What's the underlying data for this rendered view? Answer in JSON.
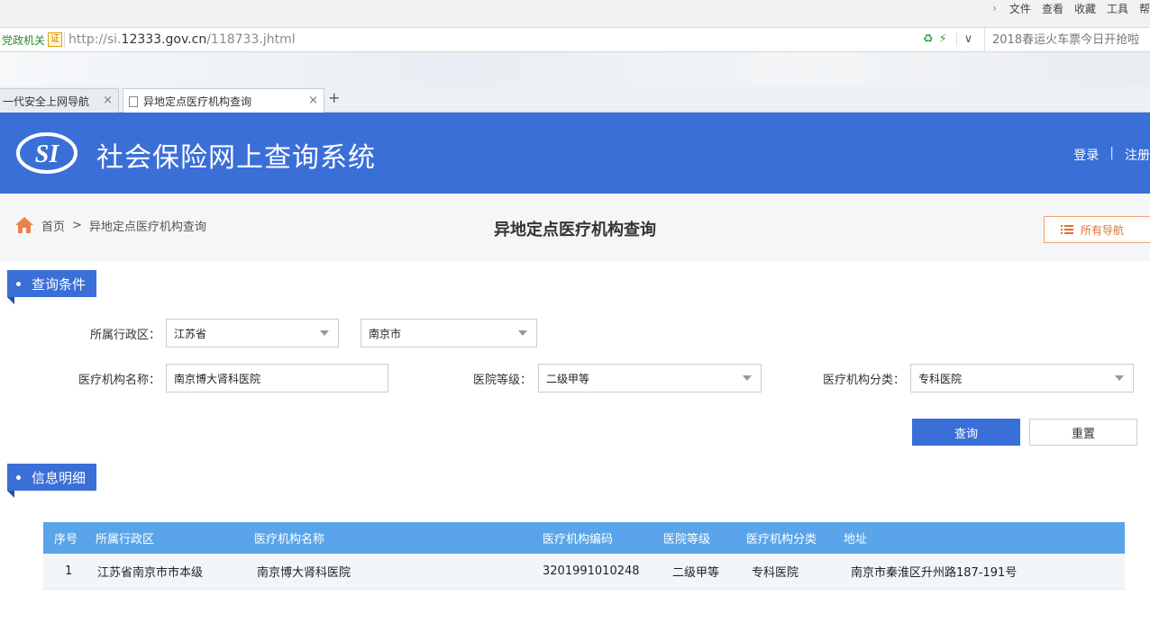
{
  "browser": {
    "menu": [
      "文件",
      "查看",
      "收藏",
      "工具",
      "帮"
    ],
    "gov_badge": "党政机关",
    "gov_badge_mark": "证",
    "url_prefix": "http://si.",
    "url_domain": "12333.gov.cn",
    "url_path": "/118733.jhtml",
    "ad_text": "2018春运火车票今日开抢啦",
    "tabs": [
      {
        "label": "一代安全上网导航",
        "active": false
      },
      {
        "label": "异地定点医疗机构查询",
        "active": true
      }
    ],
    "new_tab": "+"
  },
  "header": {
    "logo_text": "SI",
    "site_title": "社会保险网上查询系统",
    "login": "登录",
    "separator": "|",
    "register": "注册"
  },
  "breadcrumb": {
    "home": "首页",
    "sep": ">",
    "current": "异地定点医疗机构查询"
  },
  "page_title": "异地定点医疗机构查询",
  "all_nav": "所有导航",
  "query_section": {
    "title": "查询条件",
    "region_label": "所属行政区：",
    "province": "江苏省",
    "city": "南京市",
    "name_label": "医疗机构名称：",
    "name_value": "南京博大肾科医院",
    "level_label": "医院等级：",
    "level_value": "二级甲等",
    "category_label": "医疗机构分类：",
    "category_value": "专科医院",
    "query_button": "查询",
    "reset_button": "重置"
  },
  "info_section": {
    "title": "信息明细",
    "columns": [
      "序号",
      "所属行政区",
      "医疗机构名称",
      "医疗机构编码",
      "医院等级",
      "医疗机构分类",
      "地址"
    ],
    "rows": [
      [
        "1",
        "江苏省南京市市本级",
        "南京博大肾科医院",
        "3201991010248",
        "二级甲等",
        "专科医院",
        "南京市秦淮区升州路187-191号"
      ]
    ]
  },
  "colors": {
    "header_blue": "#3b6fd8",
    "table_head": "#5aa5ea",
    "accent_orange": "#e07030"
  }
}
